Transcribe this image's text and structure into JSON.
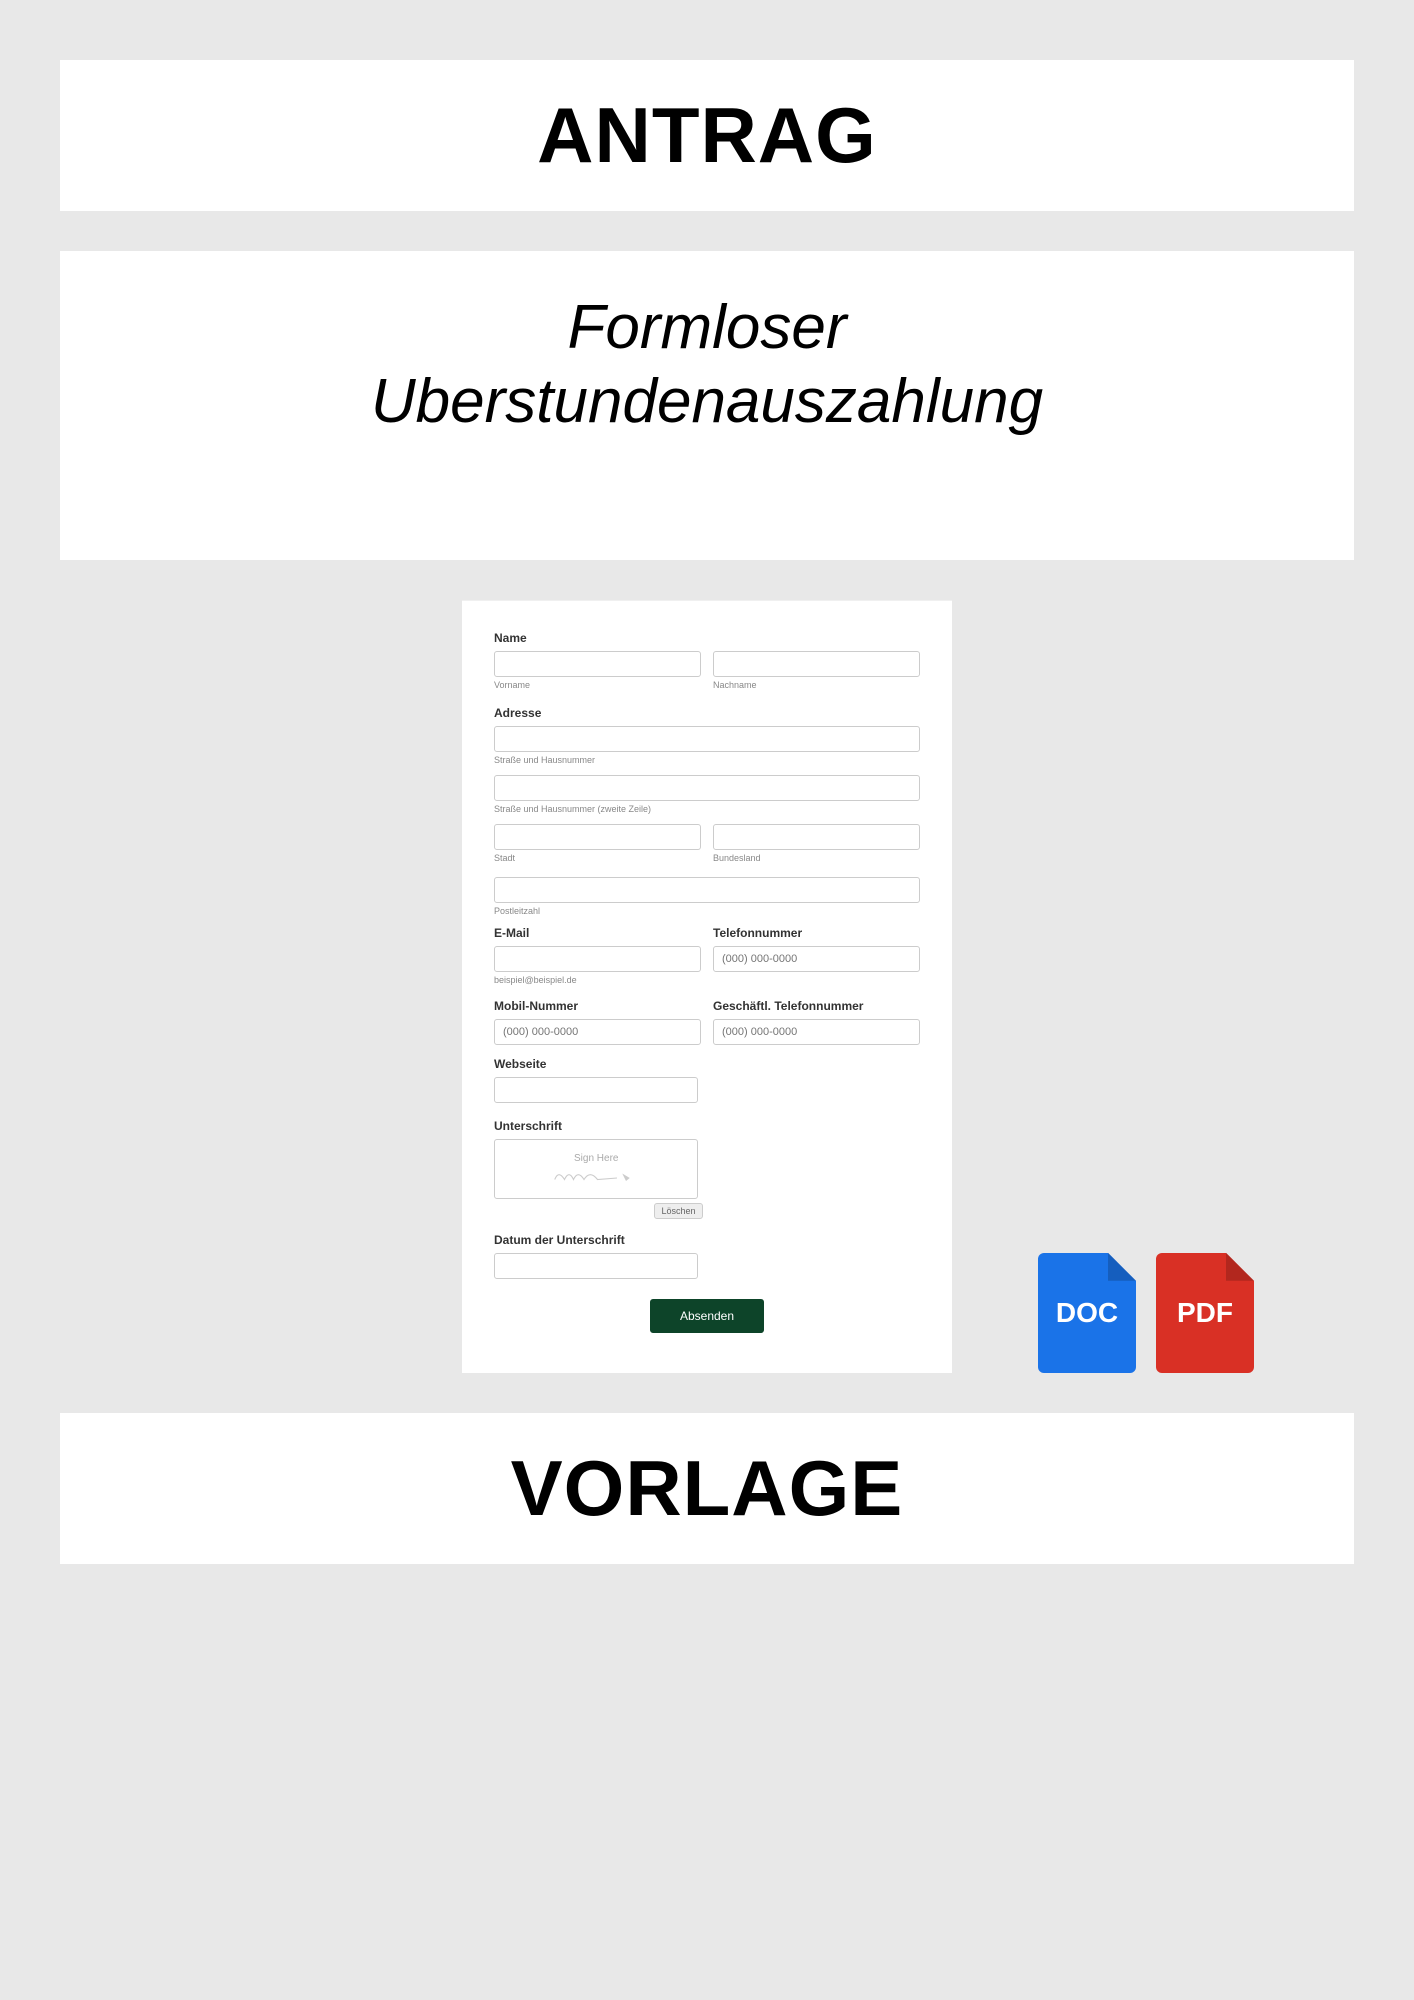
{
  "header": {
    "title": "ANTRAG"
  },
  "subtitle": {
    "line1": "Formloser",
    "line2": "Uberstundenauszahlung"
  },
  "form": {
    "name": {
      "label": "Name",
      "firstSub": "Vorname",
      "lastSub": "Nachname"
    },
    "address": {
      "label": "Adresse",
      "street1Sub": "Straße und Hausnummer",
      "street2Sub": "Straße und Hausnummer (zweite Zeile)",
      "citySub": "Stadt",
      "stateSub": "Bundesland",
      "postalSub": "Postleitzahl"
    },
    "email": {
      "label": "E-Mail",
      "sub": "beispiel@beispiel.de"
    },
    "phone": {
      "label": "Telefonnummer",
      "placeholder": "(000) 000-0000"
    },
    "mobile": {
      "label": "Mobil-Nummer",
      "placeholder": "(000) 000-0000"
    },
    "workphone": {
      "label": "Geschäftl. Telefonnummer",
      "placeholder": "(000) 000-0000"
    },
    "website": {
      "label": "Webseite"
    },
    "signature": {
      "label": "Unterschrift",
      "hint": "Sign Here",
      "clear": "Löschen"
    },
    "sigdate": {
      "label": "Datum der Unterschrift"
    },
    "submit": "Absenden"
  },
  "files": {
    "doc": "DOC",
    "pdf": "PDF"
  },
  "footer": {
    "title": "VORLAGE"
  }
}
